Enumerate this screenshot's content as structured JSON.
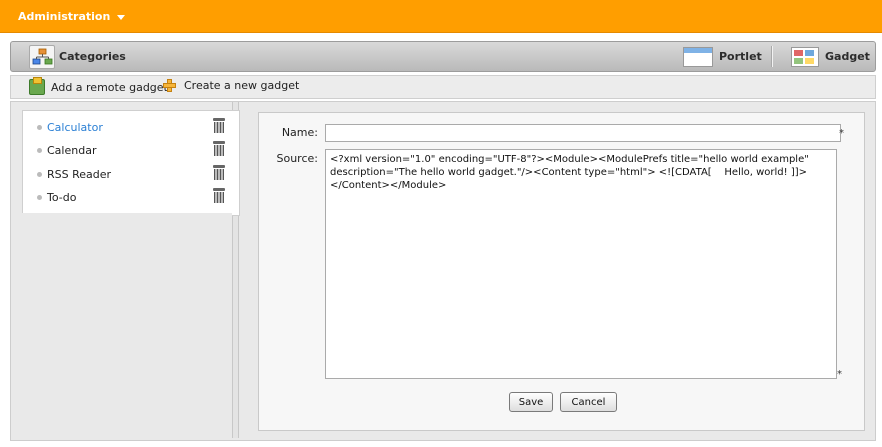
{
  "admin": {
    "title": "Administration"
  },
  "header": {
    "categories_label": "Categories",
    "portlet_label": "Portlet",
    "gadget_label": "Gadget"
  },
  "toolbar": {
    "add_remote": "Add a remote gadget",
    "create_new": "Create a new gadget"
  },
  "gadgets": [
    {
      "name": "Calculator",
      "selected": true
    },
    {
      "name": "Calendar",
      "selected": false
    },
    {
      "name": "RSS Reader",
      "selected": false
    },
    {
      "name": "To-do",
      "selected": false
    }
  ],
  "form": {
    "name_label": "Name:",
    "name_value": "",
    "source_label": "Source:",
    "source_value": "<?xml version=\"1.0\" encoding=\"UTF-8\"?><Module><ModulePrefs title=\"hello world example\" description=\"The hello world gadget.\"/><Content type=\"html\"> <![CDATA[    Hello, world! ]]></Content></Module>",
    "required_mark": "*",
    "save_label": "Save",
    "cancel_label": "Cancel"
  }
}
